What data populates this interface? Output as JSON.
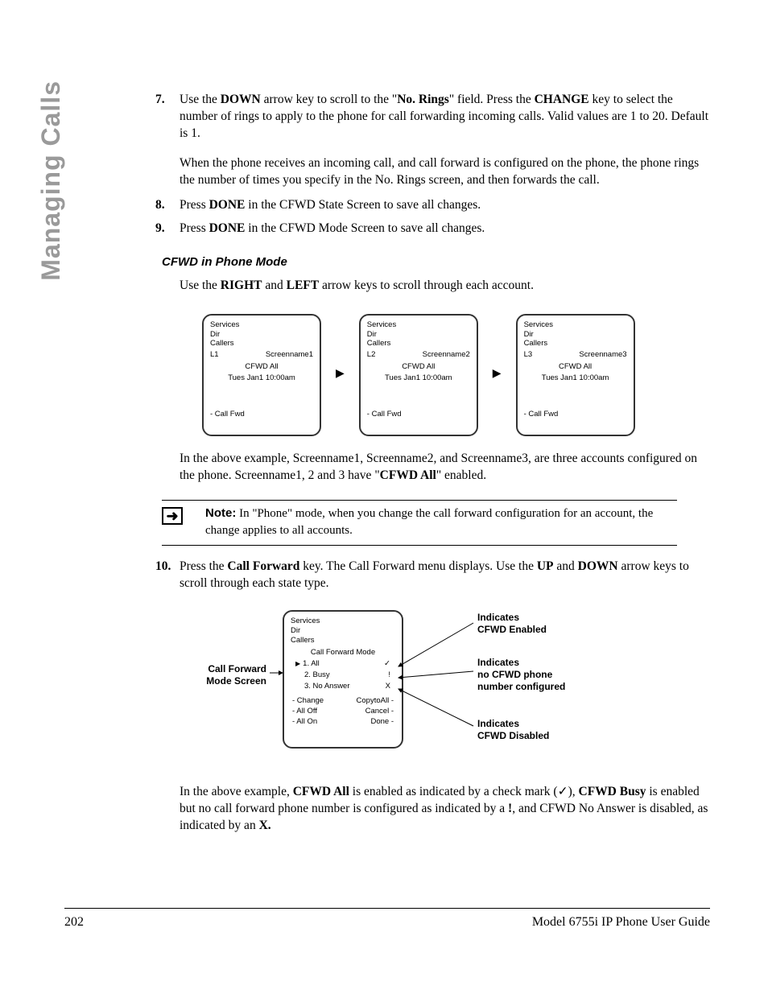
{
  "side_header": "Managing Calls",
  "steps": {
    "s7_num": "7.",
    "s7_p1_a": "Use the ",
    "s7_p1_b": "DOWN",
    "s7_p1_c": " arrow key to scroll to the \"",
    "s7_p1_d": "No. Rings",
    "s7_p1_e": "\" field. Press the ",
    "s7_p1_f": "CHANGE",
    "s7_p1_g": " key to select the number of rings to apply to the phone for call forwarding incoming calls. Valid values are 1 to 20. Default is 1.",
    "s7_p2": "When the phone receives an incoming call, and call forward is configured on the phone, the phone rings the number of times you specify in the No. Rings screen, and then forwards the call.",
    "s8_num": "8.",
    "s8_a": "Press ",
    "s8_b": "DONE",
    "s8_c": " in the CFWD State Screen to save all changes.",
    "s9_num": "9.",
    "s9_a": "Press ",
    "s9_b": "DONE",
    "s9_c": " in the CFWD Mode Screen to save all changes.",
    "s10_num": "10.",
    "s10_a": "Press the ",
    "s10_b": "Call Forward",
    "s10_c": " key. The Call Forward menu displays. Use the ",
    "s10_d": "UP",
    "s10_e": " and ",
    "s10_f": "DOWN",
    "s10_g": " arrow keys to scroll through each state type."
  },
  "sub_heading": "CFWD in Phone Mode",
  "intro_a": "Use the ",
  "intro_b": "RIGHT",
  "intro_c": " and ",
  "intro_d": "LEFT",
  "intro_e": " arrow keys to scroll through each account.",
  "screens": [
    {
      "services": "Services",
      "dir": "Dir",
      "callers": "Callers",
      "line": "L1",
      "name": "Screenname1",
      "cfwd": "CFWD All",
      "ts": "Tues Jan1 10:00am",
      "sk": "- Call Fwd"
    },
    {
      "services": "Services",
      "dir": "Dir",
      "callers": "Callers",
      "line": "L2",
      "name": "Screenname2",
      "cfwd": "CFWD All",
      "ts": "Tues Jan1 10:00am",
      "sk": "- Call Fwd"
    },
    {
      "services": "Services",
      "dir": "Dir",
      "callers": "Callers",
      "line": "L3",
      "name": "Screenname3",
      "cfwd": "CFWD All",
      "ts": "Tues Jan1 10:00am",
      "sk": "- Call Fwd"
    }
  ],
  "after_screens_a": "In the above example, Screenname1, Screenname2, and Screenname3, are three accounts configured on the phone. Screenname1, 2 and 3 have \"",
  "after_screens_b": "CFWD All",
  "after_screens_c": "\" enabled.",
  "note_label": "Note:",
  "note_text": " In \"Phone\" mode, when you change the call forward configuration for an account, the change applies to all accounts.",
  "fig2": {
    "left_label_l1": "Call Forward",
    "left_label_l2": "Mode Screen",
    "services": "Services",
    "dir": "Dir",
    "callers": "Callers",
    "mode_title": "Call Forward Mode",
    "opt1": "1. All",
    "mark1": "✓",
    "opt2": "2. Busy",
    "mark2": "!",
    "opt3": "3. No Answer",
    "mark3": "X",
    "sk_change": "- Change",
    "sk_copy": "CopytoAll -",
    "sk_alloff": "- All Off",
    "sk_cancel": "Cancel -",
    "sk_allon": "- All On",
    "sk_done": "Done -",
    "co1_l1": "Indicates",
    "co1_l2": "CFWD Enabled",
    "co2_l1": "Indicates",
    "co2_l2": "no CFWD phone",
    "co2_l3": "number configured",
    "co3_l1": "Indicates",
    "co3_l2": "CFWD Disabled"
  },
  "after_fig2_a": "In the above example, ",
  "after_fig2_b": "CFWD All",
  "after_fig2_c": " is enabled as indicated by a check mark (",
  "after_fig2_check": "✓",
  "after_fig2_d": "), ",
  "after_fig2_e": "CFWD Busy",
  "after_fig2_f": " is enabled but no call forward phone number is configured as indicated by a ",
  "after_fig2_g": "!",
  "after_fig2_h": ", and CFWD No Answer is disabled, as indicated by an ",
  "after_fig2_i": "X.",
  "footer_page": "202",
  "footer_title": "Model 6755i IP Phone User Guide",
  "arrow": "▶",
  "note_arrow": "➜",
  "pointer": "▶"
}
